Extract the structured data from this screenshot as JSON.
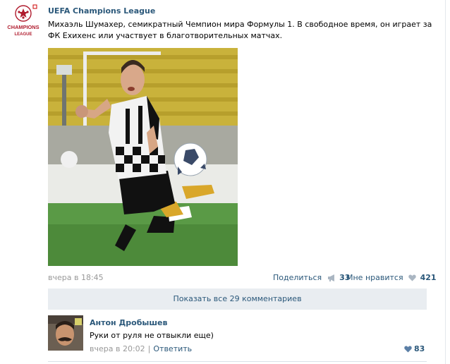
{
  "post": {
    "community_name": "UEFA Champions League",
    "avatar_text_line1": "CHAMPIONS",
    "avatar_text_line2": "LEAGUE",
    "text": "Михаэль Шумахер, семикратный Чемпион мира Формулы 1. В свободное время, он играет за ФК Ехихенс или участвует в благотворительных матчах.",
    "date": "вчера в 18:45",
    "share_label": "Поделиться",
    "share_count": "33",
    "like_label": "Мне нравится",
    "like_count": "421",
    "show_comments_label": "Показать все 29 комментариев",
    "share_icon": "megaphone-icon",
    "like_icon": "heart-icon"
  },
  "comment": {
    "author": "Антон Дробышев",
    "text": "Руки от руля не отвыкли еще)",
    "date": "вчера в 20:02",
    "separator": "|",
    "reply_label": "Ответить",
    "like_count": "83"
  },
  "colors": {
    "link": "#2b587a",
    "muted": "#999999",
    "bar_bg": "#e9edf1",
    "heart": "#aab6c2"
  }
}
